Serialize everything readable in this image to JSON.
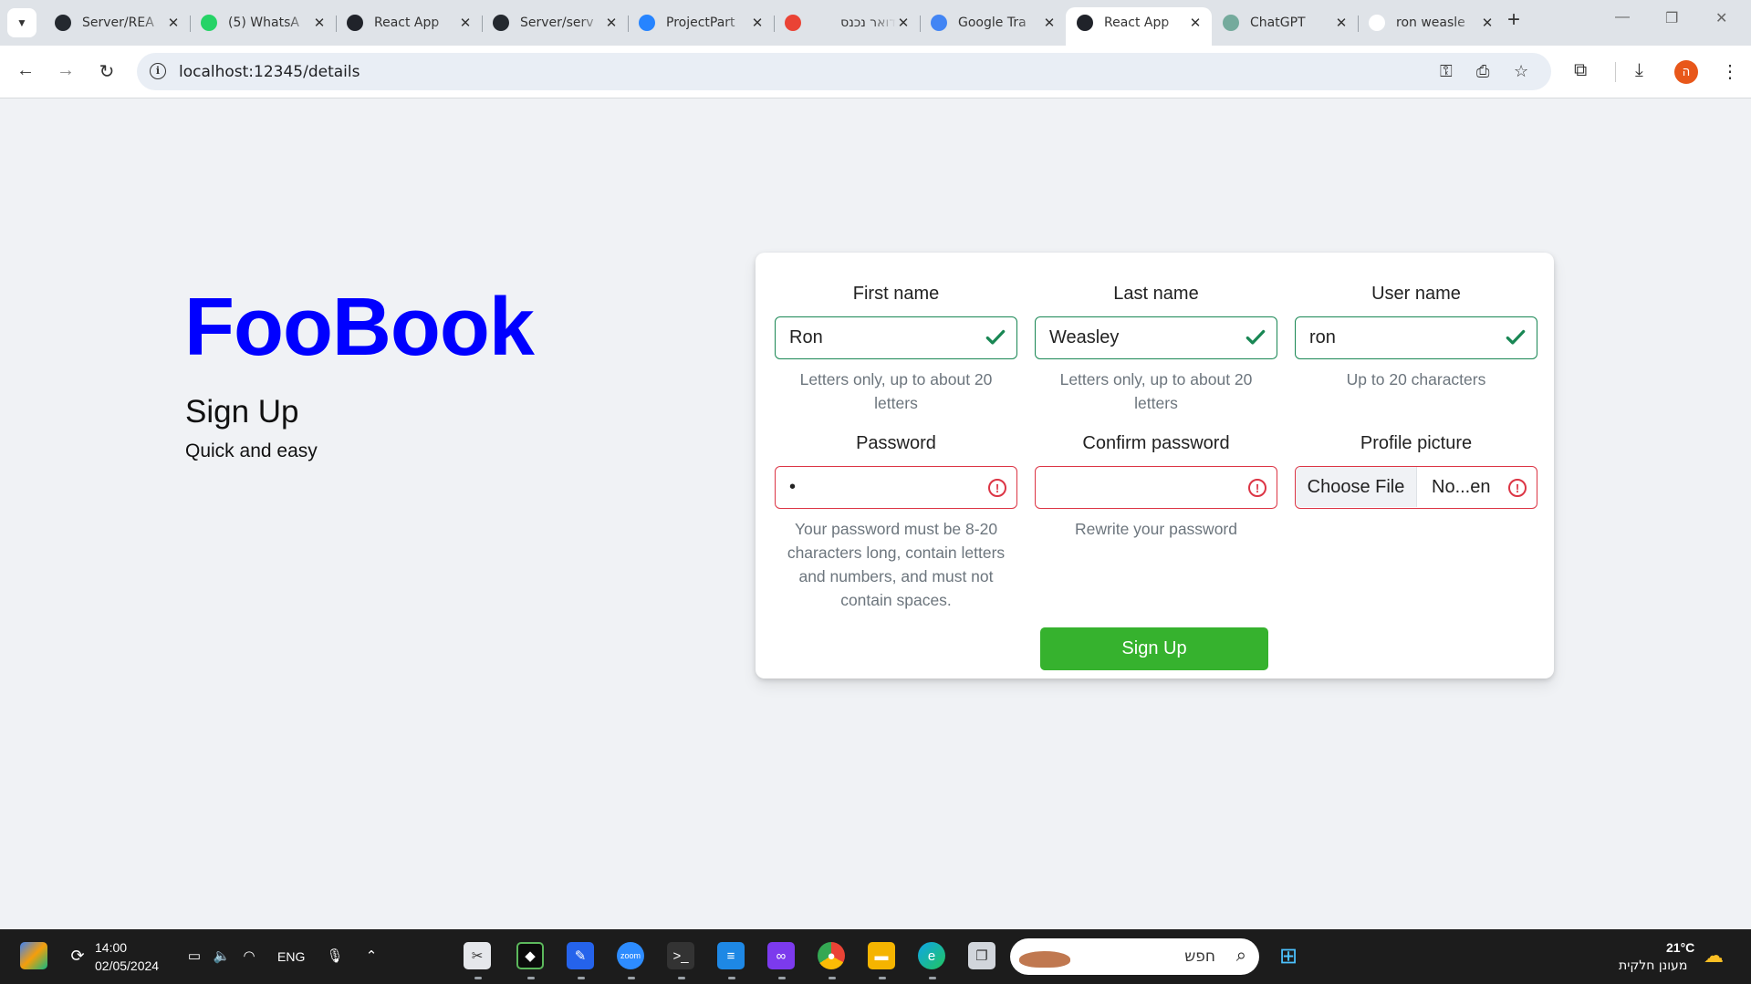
{
  "browser": {
    "tabs": [
      {
        "title": "Server/REA",
        "icon": "github-icon",
        "color": "#24292f"
      },
      {
        "title": "(5) WhatsA",
        "icon": "whatsapp-icon",
        "color": "#25d366"
      },
      {
        "title": "React App",
        "icon": "react-icon",
        "color": "#20232a"
      },
      {
        "title": "Server/serv",
        "icon": "github-icon",
        "color": "#24292f"
      },
      {
        "title": "ProjectPart",
        "icon": "jira-icon",
        "color": "#2684ff"
      },
      {
        "title": "דואר נכנס",
        "icon": "gmail-icon",
        "color": "#ea4335"
      },
      {
        "title": "Google Tra",
        "icon": "google-translate-icon",
        "color": "#4285f4"
      },
      {
        "title": "React App",
        "icon": "react-icon",
        "color": "#20232a"
      },
      {
        "title": "ChatGPT",
        "icon": "chatgpt-icon",
        "color": "#74aa9c"
      },
      {
        "title": "ron weasle",
        "icon": "google-icon",
        "color": "#ffffff"
      }
    ],
    "active_tab_index": 7,
    "url": "localhost:12345/details",
    "profile_initial": "ה"
  },
  "page": {
    "brand": "FooBook",
    "heading": "Sign Up",
    "subheading": "Quick and easy",
    "fields": {
      "first_name": {
        "label": "First name",
        "value": "Ron",
        "help": "Letters only, up to about 20 letters",
        "status": "valid"
      },
      "last_name": {
        "label": "Last name",
        "value": "Weasley",
        "help": "Letters only, up to about 20 letters",
        "status": "valid"
      },
      "user_name": {
        "label": "User name",
        "value": "ron",
        "help": "Up to 20 characters",
        "status": "valid"
      },
      "password": {
        "label": "Password",
        "value": "•",
        "help": "Your password must be 8-20 characters long, contain letters and numbers, and must not contain spaces.",
        "status": "invalid"
      },
      "confirm_password": {
        "label": "Confirm password",
        "value": "",
        "help": "Rewrite your password",
        "status": "invalid"
      },
      "profile_picture": {
        "label": "Profile picture",
        "button": "Choose File",
        "file_name": "No...en",
        "status": "invalid"
      }
    },
    "submit_label": "Sign Up",
    "colors": {
      "brand": "#0000ff",
      "valid": "#198754",
      "invalid": "#dc3545",
      "submit": "#36b22e"
    }
  },
  "taskbar": {
    "time": "14:00",
    "date": "02/05/2024",
    "language": "ENG",
    "search_placeholder": "חפש",
    "weather_temp": "21°C",
    "weather_desc": "מעונן חלקית"
  }
}
